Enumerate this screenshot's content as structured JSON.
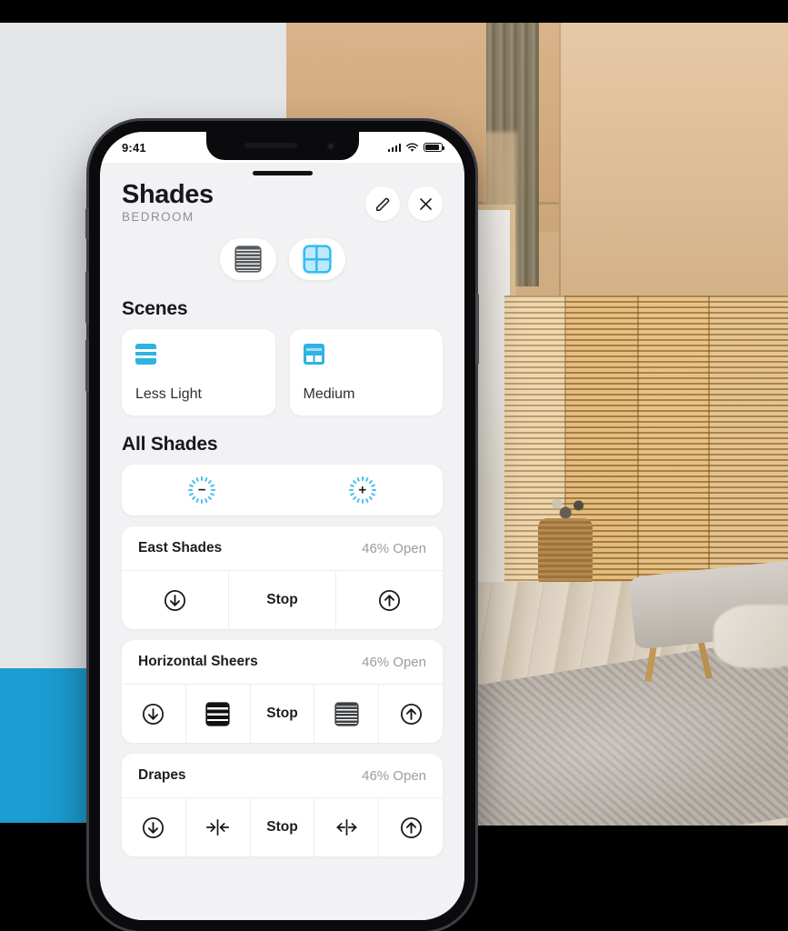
{
  "background": {
    "left_panel_color": "#e3e5e7",
    "accent_block_color": "#1b9dd1",
    "photo_description": "bedroom-with-roller-shade-window-and-wooden-room-divider"
  },
  "phone": {
    "status_bar": {
      "time": "9:41",
      "cellular_icon": "signal-bars-icon",
      "wifi_icon": "wifi-icon",
      "battery_icon": "battery-icon"
    },
    "header": {
      "title": "Shades",
      "subtitle": "BEDROOM",
      "edit_icon": "pencil-icon",
      "close_icon": "close-icon"
    },
    "view_toggle": [
      {
        "name": "list-view",
        "icon": "horizontal-blinds-icon",
        "selected": false
      },
      {
        "name": "grid-view",
        "icon": "window-grid-icon",
        "selected": true
      }
    ],
    "scenes": {
      "heading": "Scenes",
      "items": [
        {
          "label": "Less Light",
          "icon": "shade-lines-icon"
        },
        {
          "label": "Medium",
          "icon": "window-half-shade-icon"
        }
      ]
    },
    "all_shades": {
      "heading": "All Shades",
      "controls": [
        {
          "name": "dim-down",
          "icon": "brightness-minus-icon",
          "sign": "−"
        },
        {
          "name": "dim-up",
          "icon": "brightness-plus-icon",
          "sign": "+"
        }
      ]
    },
    "devices": [
      {
        "name": "East Shades",
        "state": "46% Open",
        "controls": [
          {
            "type": "icon",
            "name": "lower-button",
            "icon": "arrow-down-circle-icon"
          },
          {
            "type": "text",
            "name": "stop-button",
            "label": "Stop"
          },
          {
            "type": "icon",
            "name": "raise-button",
            "icon": "arrow-up-circle-icon"
          }
        ]
      },
      {
        "name": "Horizontal Sheers",
        "state": "46% Open",
        "controls": [
          {
            "type": "icon",
            "name": "lower-button",
            "icon": "arrow-down-circle-icon"
          },
          {
            "type": "icon",
            "name": "vanes-open-button",
            "icon": "wide-stripes-icon"
          },
          {
            "type": "text",
            "name": "stop-button",
            "label": "Stop"
          },
          {
            "type": "icon",
            "name": "vanes-closed-button",
            "icon": "narrow-stripes-icon"
          },
          {
            "type": "icon",
            "name": "raise-button",
            "icon": "arrow-up-circle-icon"
          }
        ]
      },
      {
        "name": "Drapes",
        "state": "46% Open",
        "controls": [
          {
            "type": "icon",
            "name": "lower-button",
            "icon": "arrow-down-circle-icon"
          },
          {
            "type": "icon",
            "name": "close-drapes-button",
            "icon": "arrows-inward-icon"
          },
          {
            "type": "text",
            "name": "stop-button",
            "label": "Stop"
          },
          {
            "type": "icon",
            "name": "open-drapes-button",
            "icon": "arrows-outward-icon"
          },
          {
            "type": "icon",
            "name": "raise-button",
            "icon": "arrow-up-circle-icon"
          }
        ]
      }
    ]
  },
  "colors": {
    "accent_blue": "#2fb3e0",
    "ray_blue": "#49c0ea",
    "text_dark": "#16181c",
    "text_muted": "#9a9da2"
  }
}
